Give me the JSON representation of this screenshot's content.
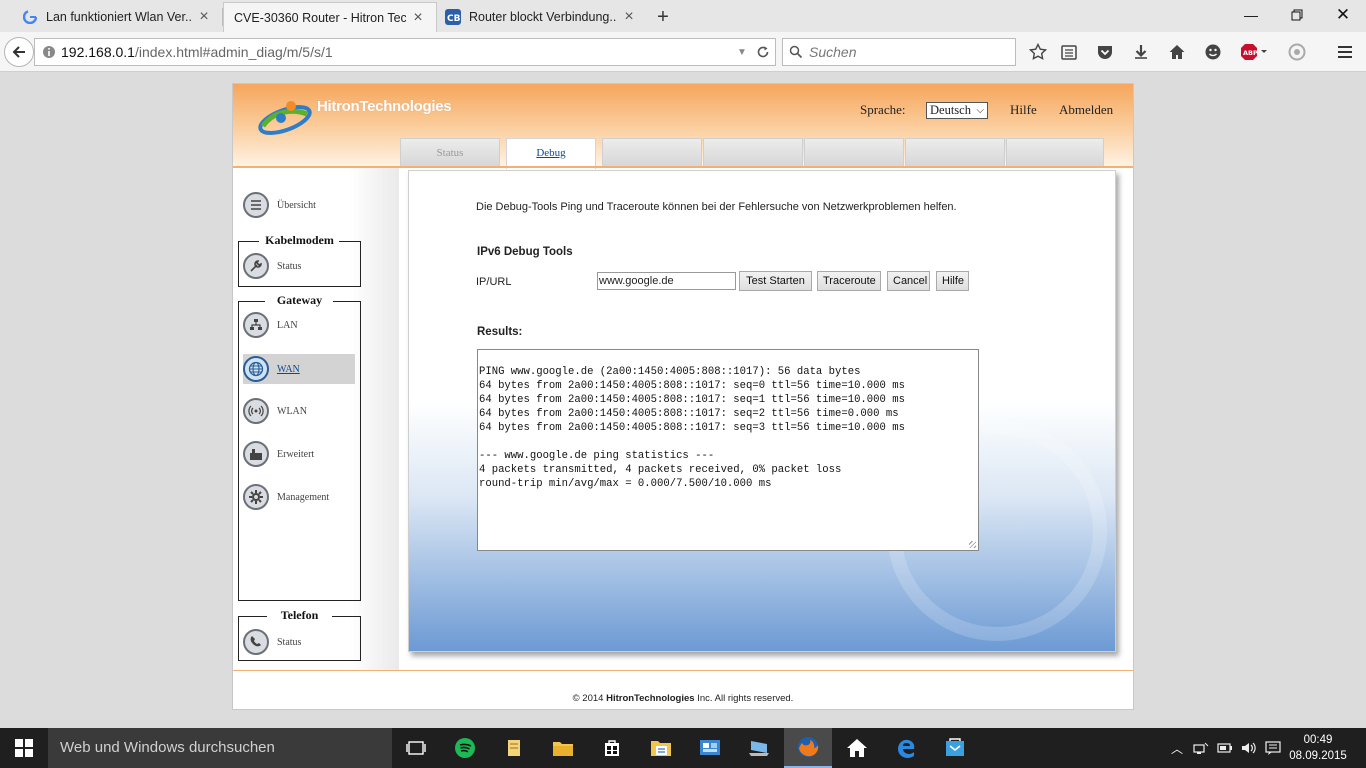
{
  "browser": {
    "tabs": [
      {
        "title": "Lan funktioniert Wlan Ver...",
        "icon": "google-icon",
        "active": false
      },
      {
        "title": "CVE-30360 Router - Hitron Tec...",
        "icon": "none",
        "active": true
      },
      {
        "title": "Router blockt Verbindung...",
        "icon": "cb-icon",
        "active": false
      }
    ],
    "new_tab": "+",
    "url_host": "192.168.0.1",
    "url_rest": "/index.html#admin_diag/m/5/s/1",
    "search_placeholder": "Suchen"
  },
  "router": {
    "brand": "HitronTechnologies",
    "lang_label": "Sprache:",
    "lang_value": "Deutsch",
    "help_link": "Hilfe",
    "logout_link": "Abmelden",
    "tabs": [
      "Status",
      "Debug",
      "",
      "",
      "",
      "",
      ""
    ],
    "sidebar": {
      "overview": "Übersicht",
      "cablemodem": {
        "title": "Kabelmodem",
        "items": [
          "Status"
        ]
      },
      "gateway": {
        "title": "Gateway",
        "items": [
          "LAN",
          "WAN",
          "WLAN",
          "Erweitert",
          "Management"
        ]
      },
      "telefon": {
        "title": "Telefon",
        "items": [
          "Status"
        ]
      }
    },
    "intro": "Die Debug-Tools Ping und Traceroute können bei der Fehlersuche von Netzwerkproblemen helfen.",
    "section_title": "IPv6 Debug Tools",
    "ip_label": "IP/URL",
    "ip_value": "www.google.de",
    "buttons": {
      "test": "Test Starten",
      "traceroute": "Traceroute",
      "cancel": "Cancel",
      "help": "Hilfe"
    },
    "results_label": "Results:",
    "results_text": "PING www.google.de (2a00:1450:4005:808::1017): 56 data bytes\n64 bytes from 2a00:1450:4005:808::1017: seq=0 ttl=56 time=10.000 ms\n64 bytes from 2a00:1450:4005:808::1017: seq=1 ttl=56 time=10.000 ms\n64 bytes from 2a00:1450:4005:808::1017: seq=2 ttl=56 time=0.000 ms\n64 bytes from 2a00:1450:4005:808::1017: seq=3 ttl=56 time=10.000 ms\n\n--- www.google.de ping statistics ---\n4 packets transmitted, 4 packets received, 0% packet loss\nround-trip min/avg/max = 0.000/7.500/10.000 ms",
    "footer_prefix": "© 2014",
    "footer_brand": "HitronTechnologies",
    "footer_suffix": "Inc.  All rights reserved."
  },
  "taskbar": {
    "search_placeholder": "Web und Windows durchsuchen",
    "time": "00:49",
    "date": "08.09.2015"
  }
}
